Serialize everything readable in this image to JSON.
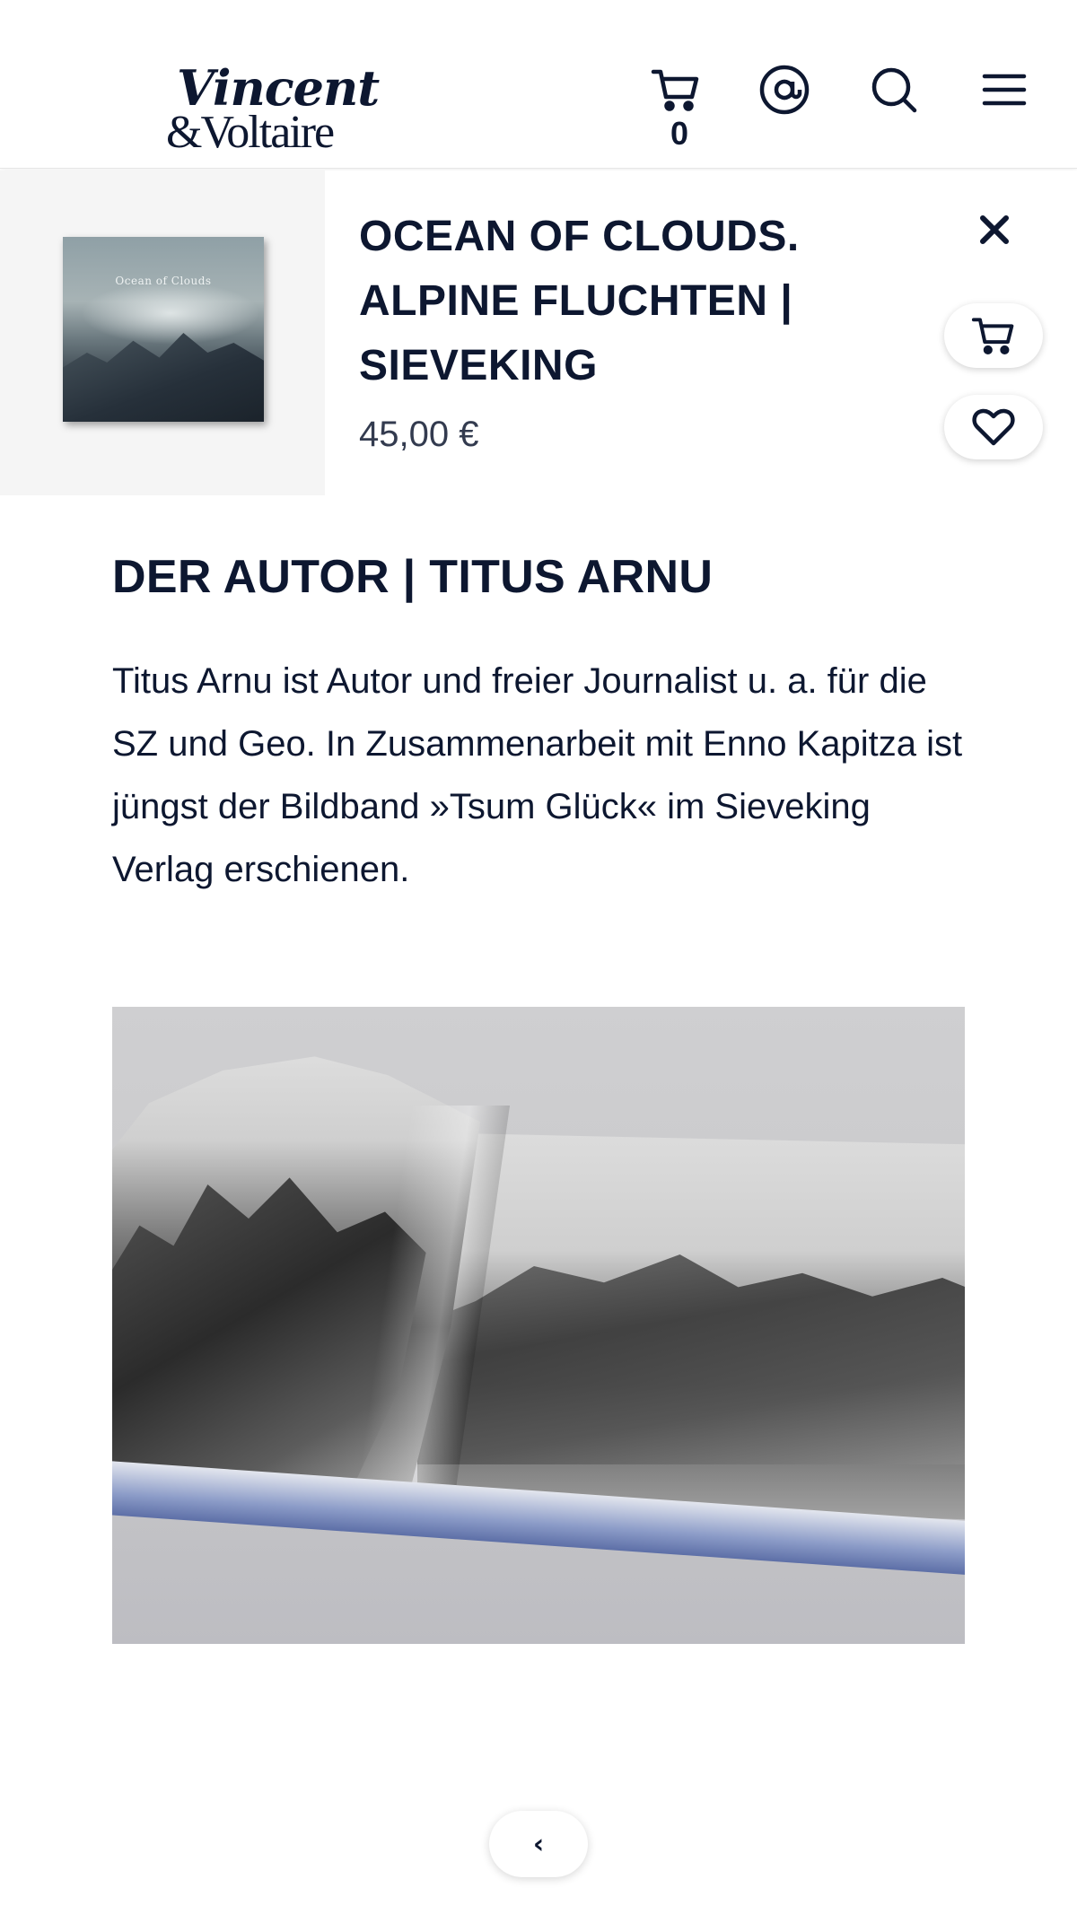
{
  "header": {
    "logo_line1": "Vincent",
    "logo_line2": "&Voltaire",
    "cart_count": "0",
    "icons": [
      "cart-icon",
      "account-icon",
      "search-icon",
      "menu-icon"
    ]
  },
  "product": {
    "thumbnail_title": "Ocean of Clouds",
    "title": "OCEAN OF CLOUDS. ALPINE FLUCHTEN | SIEVEKING",
    "price": "45,00 €",
    "actions": [
      "close-icon",
      "cart-icon",
      "heart-icon"
    ]
  },
  "content": {
    "heading": "DER AUTOR | TITUS ARNU",
    "paragraph": "Titus Arnu ist Autor und freier Journalist u. a. für die SZ und Geo. In Zusammenarbeit mit Enno Kapitza ist jüngst der Bildband »Tsum Glück« im Sieveking Verlag erschienen."
  },
  "pagination": {
    "back_label": "‹"
  },
  "colors": {
    "text": "#0d1730",
    "price": "#333b4f",
    "thumb_bg": "#f5f5f5"
  }
}
